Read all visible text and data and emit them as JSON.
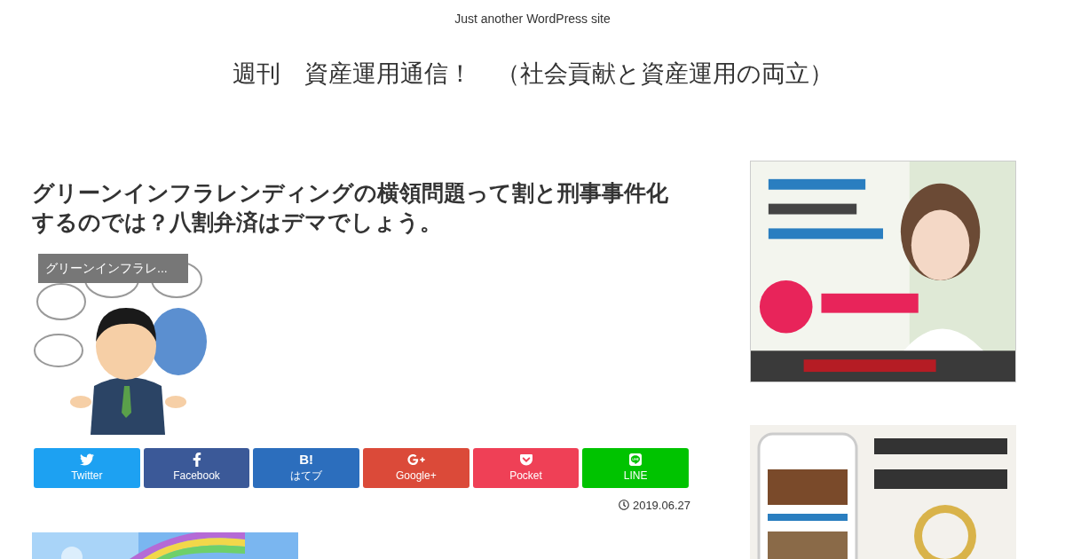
{
  "site": {
    "tagline": "Just another WordPress site",
    "title": "週刊　資産運用通信！　（社会貢献と資産運用の両立）"
  },
  "article": {
    "title": "グリーンインフラレンディングの横領問題って割と刑事事件化するのでは？八割弁済はデマでしょう。",
    "category": "グリーンインフラレ...",
    "date": "2019.06.27",
    "share_buttons": [
      {
        "kind": "twitter",
        "label": "Twitter",
        "color": "#1da1f2"
      },
      {
        "kind": "facebook",
        "label": "Facebook",
        "color": "#3b5998"
      },
      {
        "kind": "hatena",
        "label": "はてブ",
        "icon_text": "B!",
        "color": "#2c6ebd"
      },
      {
        "kind": "google",
        "label": "Google+",
        "color": "#db4a39"
      },
      {
        "kind": "pocket",
        "label": "Pocket",
        "color": "#ef4056"
      },
      {
        "kind": "line",
        "label": "LINE",
        "color": "#00c300"
      }
    ]
  }
}
